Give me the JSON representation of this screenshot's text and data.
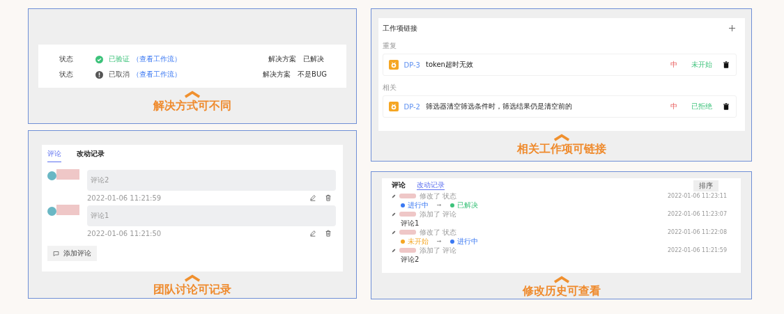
{
  "resolution_panel": {
    "rows": [
      {
        "label": "状态",
        "kind": "verified",
        "status": "已验证",
        "link": "（查看工作流）",
        "resolution_label": "解决方案",
        "resolution": "已解决"
      },
      {
        "label": "状态",
        "kind": "cancelled",
        "status": "已取消",
        "link": "（查看工作流）",
        "resolution_label": "解决方案",
        "resolution": "不是BUG"
      }
    ],
    "caption": "解决方式可不同"
  },
  "comments_panel": {
    "tabs": [
      {
        "label": "评论",
        "selected": true
      },
      {
        "label": "改动记录",
        "selected": false
      }
    ],
    "comments": [
      {
        "text": "评论2",
        "time": "2022-01-06 11:21:59"
      },
      {
        "text": "评论1",
        "time": "2022-01-06 11:21:50"
      }
    ],
    "add_button": "添加评论",
    "caption": "团队讨论可记录"
  },
  "links_panel": {
    "title": "工作项链接",
    "groups": [
      {
        "label": "重复",
        "items": [
          {
            "id": "DP-3",
            "title": "token超时无效",
            "priority": "中",
            "status": "未开始"
          }
        ]
      },
      {
        "label": "相关",
        "items": [
          {
            "id": "DP-2",
            "title": "筛选器清空筛选条件时，筛选结果仍是清空前的",
            "priority": "中",
            "status": "已拒绝"
          }
        ]
      }
    ],
    "caption": "相关工作项可链接"
  },
  "history_panel": {
    "tabs": [
      {
        "label": "评论",
        "selected": false
      },
      {
        "label": "改动记录",
        "selected": true
      }
    ],
    "sort_button": "排序",
    "entries": [
      {
        "kind": "change",
        "action": "修改了 状态",
        "time": "2022-01-06 11:23:11",
        "from": {
          "label": "进行中",
          "color": "#3a78f2"
        },
        "to": {
          "label": "已解决",
          "color": "#3cc27a"
        }
      },
      {
        "kind": "comment",
        "action": "添加了 评论",
        "time": "2022-01-06 11:23:07",
        "text": "评论1"
      },
      {
        "kind": "change",
        "action": "修改了 状态",
        "time": "2022-01-06 11:22:08",
        "from": {
          "label": "未开始",
          "color": "#f5a623"
        },
        "to": {
          "label": "进行中",
          "color": "#3a78f2"
        }
      },
      {
        "kind": "comment",
        "action": "添加了 评论",
        "time": "2022-01-06 11:21:59",
        "text": "评论2"
      }
    ],
    "caption": "修改历史可查看"
  }
}
